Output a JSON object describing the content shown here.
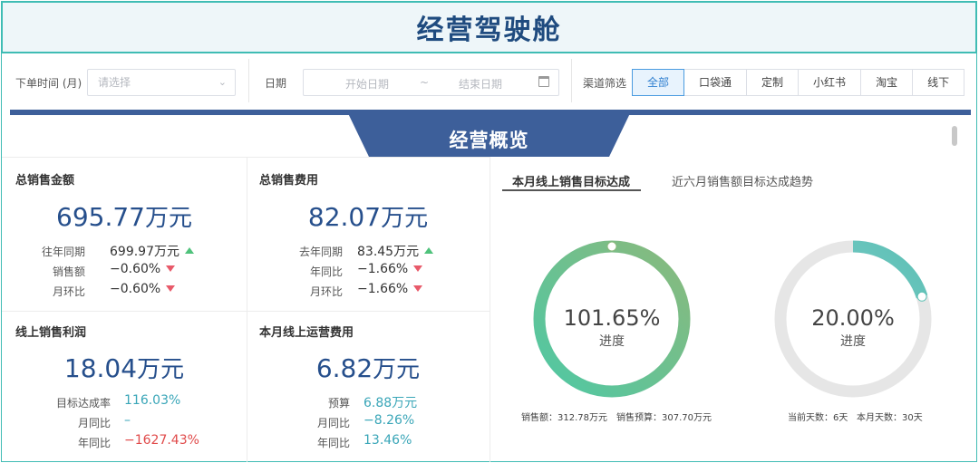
{
  "page_title": "经营驾驶舱",
  "filters": {
    "order_time_label": "下单时间 (月)",
    "order_time_placeholder": "请选择",
    "date_label": "日期",
    "start_date_placeholder": "开始日期",
    "date_separator": "~",
    "end_date_placeholder": "结束日期",
    "channel_label": "渠道筛选",
    "channels": [
      "全部",
      "口袋通",
      "定制",
      "小红书",
      "淘宝",
      "线下"
    ],
    "active_channel": "全部"
  },
  "section_title": "经营概览",
  "cards": {
    "total_sales": {
      "title": "总销售金额",
      "value": "695.77",
      "unit": "万元",
      "unit_suffix": "元",
      "rows": [
        {
          "label": "往年同期",
          "value": "699.97万元",
          "trend": "up"
        },
        {
          "label": "销售额",
          "value": "−0.60%",
          "trend": "down"
        },
        {
          "label": "月环比",
          "value": "−0.60%",
          "trend": "down"
        }
      ]
    },
    "total_cost": {
      "title": "总销售费用",
      "value": "82.07",
      "unit": "万元",
      "rows": [
        {
          "label": "去年同期",
          "value": "83.45万元",
          "trend": "up"
        },
        {
          "label": "年同比",
          "value": "−1.66%",
          "trend": "down"
        },
        {
          "label": "月环比",
          "value": "−1.66%",
          "trend": "down"
        }
      ]
    },
    "online_profit": {
      "title": "线上销售利润",
      "value": "18.04",
      "unit": "万元",
      "rows": [
        {
          "label": "目标达成率",
          "value": "116.03%"
        },
        {
          "label": "月同比",
          "value": "–"
        },
        {
          "label": "年同比",
          "value": "−1627.43%"
        }
      ]
    },
    "online_ops_cost": {
      "title": "本月线上运营费用",
      "value": "6.82",
      "unit": "万元",
      "rows": [
        {
          "label": "预算",
          "value": "6.88万元"
        },
        {
          "label": "月同比",
          "value": "−8.26%"
        },
        {
          "label": "年同比",
          "value": "13.46%"
        }
      ]
    }
  },
  "right_panel": {
    "tabs": [
      "本月线上销售目标达成",
      "近六月销售额目标达成趋势"
    ],
    "active_tab": 0,
    "gauges": [
      {
        "percent_text": "101.65%",
        "progress": 1.0,
        "sub": "进度",
        "foot_left": "销售额：312.78万元",
        "foot_right": "销售预算：307.70万元",
        "color_start": "#4fc8a4",
        "color_end": "#8ab97c"
      },
      {
        "percent_text": "20.00%",
        "progress": 0.2,
        "sub": "进度",
        "foot_left": "当前天数：6天",
        "foot_right": "本月天数：30天",
        "color_start": "#8fd1d6",
        "color_end": "#5cc0b4"
      }
    ]
  },
  "colors": {
    "accent_teal": "#3fbcb4",
    "title_navy": "#1f4b7f",
    "ribbon": "#3d5f9a",
    "value_blue": "#264f8c",
    "trend_up": "#4fc27b",
    "trend_down": "#e85a6a"
  }
}
